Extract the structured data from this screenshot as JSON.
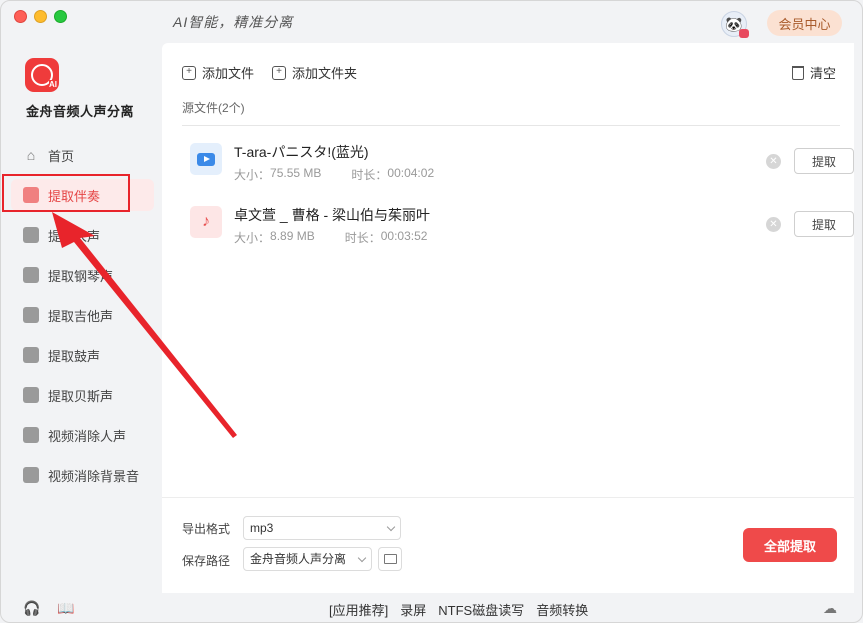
{
  "app": {
    "slogan": "AI智能，精准分离",
    "name": "金舟音频人声分离",
    "member_button": "会员中心"
  },
  "sidebar": {
    "items": [
      {
        "label": "首页",
        "icon": "home-icon"
      },
      {
        "label": "提取伴奏",
        "icon": "accompaniment-icon",
        "active": true
      },
      {
        "label": "提取人声",
        "icon": "vocal-icon"
      },
      {
        "label": "提取钢琴声",
        "icon": "piano-icon"
      },
      {
        "label": "提取吉他声",
        "icon": "guitar-icon"
      },
      {
        "label": "提取鼓声",
        "icon": "drum-icon"
      },
      {
        "label": "提取贝斯声",
        "icon": "bass-icon"
      },
      {
        "label": "视频消除人声",
        "icon": "video-vocal-remove-icon"
      },
      {
        "label": "视频消除背景音",
        "icon": "video-bg-remove-icon"
      }
    ]
  },
  "toolbar": {
    "add_file": "添加文件",
    "add_folder": "添加文件夹",
    "clear": "清空"
  },
  "source": {
    "label": "源文件(2个)"
  },
  "files": [
    {
      "name": "T-ara-パニスタ!(蓝光)",
      "size_label": "大小：",
      "size": "75.55 MB",
      "duration_label": "时长：",
      "duration": "00:04:02",
      "type": "video",
      "extract_label": "提取"
    },
    {
      "name": "卓文萱 _ 曹格 - 梁山伯与茱丽叶",
      "size_label": "大小：",
      "size": "8.89 MB",
      "duration_label": "时长：",
      "duration": "00:03:52",
      "type": "audio",
      "extract_label": "提取"
    }
  ],
  "output": {
    "format_label": "导出格式",
    "format_value": "mp3",
    "path_label": "保存路径",
    "path_value": "金舟音频人声分离",
    "extract_all": "全部提取"
  },
  "footer": {
    "recommend": "[应用推荐]",
    "links": [
      "录屏",
      "NTFS磁盘读写",
      "音频转换"
    ]
  },
  "colors": {
    "accent": "#ef4a4a",
    "annotation": "#e8242b"
  }
}
